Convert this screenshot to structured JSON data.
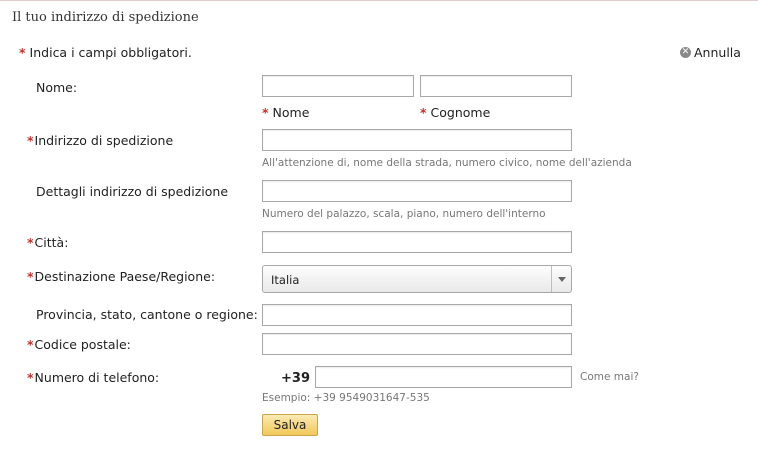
{
  "section_title": "Il tuo indirizzo di spedizione",
  "required_note": "Indica i campi obbligatori.",
  "required_mark": "*",
  "cancel_label": "Annulla",
  "fields": {
    "name": {
      "label": "Nome:",
      "first_name_label": "Nome",
      "last_name_label": "Cognome",
      "first_value": "",
      "last_value": ""
    },
    "address": {
      "label": "Indirizzo di spedizione",
      "hint": "All'attenzione di, nome della strada, numero civico, nome dell'azienda",
      "value": ""
    },
    "address_details": {
      "label": "Dettagli indirizzo di spedizione",
      "hint": "Numero del palazzo, scala, piano, numero dell'interno",
      "value": ""
    },
    "city": {
      "label": "Città:",
      "value": ""
    },
    "country": {
      "label": "Destinazione Paese/Regione:",
      "selected": "Italia"
    },
    "province": {
      "label": "Provincia, stato, cantone o regione:",
      "value": ""
    },
    "postal_code": {
      "label": "Codice postale:",
      "value": ""
    },
    "phone": {
      "label": "Numero di telefono:",
      "prefix": "+39",
      "value": "",
      "why_link": "Come mai?",
      "example": "Esempio: +39 9549031647-535"
    }
  },
  "save_label": "Salva",
  "colors": {
    "required_star": "#c4302b",
    "save_button": "#f1c859",
    "hint_text": "#777777"
  }
}
